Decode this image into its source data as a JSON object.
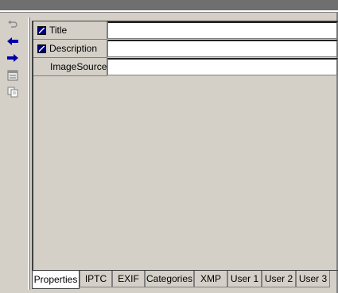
{
  "toolbar": {
    "items": [
      {
        "icon": "undo-icon"
      },
      {
        "icon": "arrow-left-icon",
        "color": "#0000a8"
      },
      {
        "icon": "arrow-right-icon",
        "color": "#0000a8"
      },
      {
        "icon": "calendar-icon"
      },
      {
        "icon": "copy-icon"
      }
    ]
  },
  "properties": [
    {
      "name": "Title",
      "value": "",
      "linked": true
    },
    {
      "name": "Description",
      "value": "",
      "linked": true
    },
    {
      "name": "ImageSource",
      "value": "",
      "linked": false
    }
  ],
  "tabs": {
    "active": "Properties",
    "items": [
      "Properties",
      "IPTC",
      "EXIF",
      "Categories",
      "XMP",
      "User 1",
      "User 2",
      "User 3"
    ]
  },
  "colors": {
    "window_bg": "#d4d0c8",
    "title_bar": "#6f6f6f",
    "arrow": "#0000a8",
    "value_bg": "#ffffff"
  }
}
